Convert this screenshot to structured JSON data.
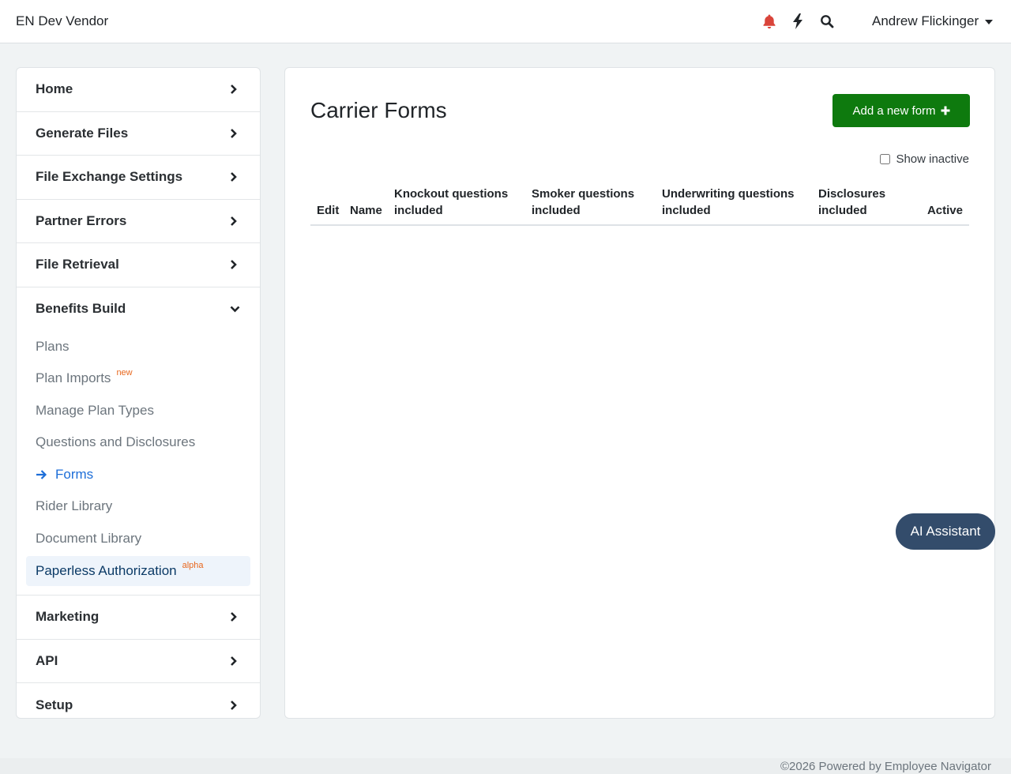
{
  "header": {
    "brand": "EN Dev Vendor",
    "user_name": "Andrew Flickinger",
    "icons": [
      "bell-icon",
      "bolt-icon",
      "search-icon"
    ],
    "bell_color": "#d9443a"
  },
  "sidebar": {
    "sections_top": [
      {
        "label": "Home"
      },
      {
        "label": "Generate Files"
      },
      {
        "label": "File Exchange Settings"
      },
      {
        "label": "Partner Errors"
      },
      {
        "label": "File Retrieval"
      }
    ],
    "benefits": {
      "label": "Benefits Build",
      "items": [
        {
          "label": "Plans"
        },
        {
          "label": "Plan Imports",
          "badge": "new"
        },
        {
          "label": "Manage Plan Types"
        },
        {
          "label": "Questions and Disclosures"
        },
        {
          "label": "Forms"
        },
        {
          "label": "Rider Library"
        },
        {
          "label": "Document Library"
        },
        {
          "label": "Paperless Authorization",
          "badge": "alpha"
        }
      ]
    },
    "sections_bottom": [
      {
        "label": "Marketing"
      },
      {
        "label": "API"
      },
      {
        "label": "Setup"
      }
    ]
  },
  "main": {
    "title": "Carrier Forms",
    "add_button": "Add a new form",
    "show_inactive_label": "Show inactive",
    "columns": [
      {
        "l1": "Edit",
        "l2": ""
      },
      {
        "l1": "Name",
        "l2": ""
      },
      {
        "l1": "Knockout questions",
        "l2": "included"
      },
      {
        "l1": "Smoker questions",
        "l2": "included"
      },
      {
        "l1": "Underwriting questions",
        "l2": "included"
      },
      {
        "l1": "Disclosures",
        "l2": "included"
      },
      {
        "l1": "Active",
        "l2": ""
      }
    ]
  },
  "ai_assistant": "AI Assistant",
  "footer": "©2026 Powered by Employee Navigator",
  "colors": {
    "primary_button": "#0e7a0e",
    "ai_button": "#334c6b",
    "active_link": "#1d6ed8",
    "badge": "#e8671d"
  }
}
